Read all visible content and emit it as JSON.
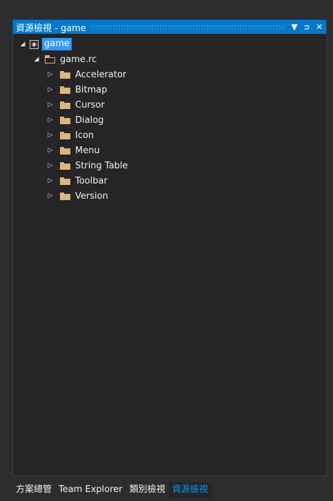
{
  "window": {
    "title": "資源檢視 - game",
    "dropdown_icon": "chevron-down-icon",
    "pin_icon": "pin-icon",
    "close_icon": "close-icon"
  },
  "tree": {
    "project": {
      "label": "game",
      "icon": "project-icon",
      "expanded": true
    },
    "rc_file": {
      "label": "game.rc",
      "icon": "resource-file-icon",
      "expanded": true
    },
    "folders": [
      {
        "label": "Accelerator"
      },
      {
        "label": "Bitmap"
      },
      {
        "label": "Cursor"
      },
      {
        "label": "Dialog"
      },
      {
        "label": "Icon"
      },
      {
        "label": "Menu"
      },
      {
        "label": "String Table"
      },
      {
        "label": "Toolbar"
      },
      {
        "label": "Version"
      }
    ]
  },
  "bottom_tabs": [
    {
      "label": "方案總管",
      "active": false
    },
    {
      "label": "Team Explorer",
      "active": false
    },
    {
      "label": "類別檢視",
      "active": false
    },
    {
      "label": "資源檢視",
      "active": true
    }
  ],
  "colors": {
    "accent": "#007acc",
    "selection": "#3399ff",
    "folder": "#dcb67a",
    "active_tab_text": "#0097fb"
  }
}
